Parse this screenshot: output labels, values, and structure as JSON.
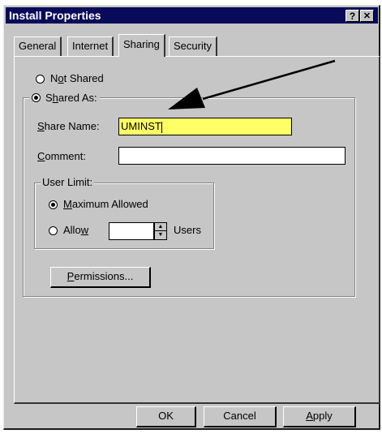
{
  "window": {
    "title": "Install Properties",
    "help_btn": "?",
    "close_btn": "✕"
  },
  "tabs": [
    {
      "label": "General"
    },
    {
      "label": "Internet"
    },
    {
      "label": "Sharing"
    },
    {
      "label": "Security"
    }
  ],
  "sharing": {
    "not_shared_pre": "N",
    "not_shared_acc": "o",
    "not_shared_post": "t Shared",
    "shared_as_pre": "S",
    "shared_as_acc": "h",
    "shared_as_post": "ared As:",
    "share_name_acc": "S",
    "share_name_post": "hare Name:",
    "share_name_value": "UMINST",
    "comment_acc": "C",
    "comment_post": "omment:",
    "comment_value": "",
    "user_limit_label": "User Limit:",
    "max_allowed_acc": "M",
    "max_allowed_post": "aximum Allowed",
    "allow_pre": "Allo",
    "allow_acc": "w",
    "allow_value": "",
    "users_label": "Users",
    "permissions_acc": "P",
    "permissions_post": "ermissions...",
    "selected_option": "Shared As",
    "user_limit_selected": "Maximum Allowed"
  },
  "footer": {
    "ok": "OK",
    "cancel": "Cancel",
    "apply_acc": "A",
    "apply_post": "pply"
  },
  "colors": {
    "highlight": "#ffff66",
    "titlebar": "#0a0a5a",
    "face": "#c6c6c6"
  },
  "annotation": "arrow pointing to share name field"
}
